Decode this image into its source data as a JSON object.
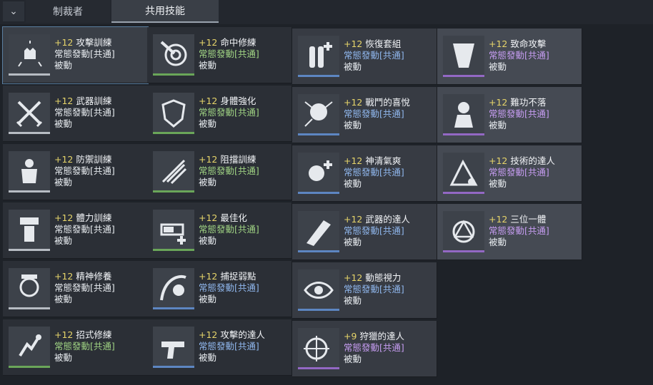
{
  "tabs": [
    "制裁者",
    "共用技能"
  ],
  "active_tab": 1,
  "columns": [
    [
      {
        "lvl": "+12",
        "name": "攻擊訓練",
        "type": "常態發動[共通]",
        "passive": "被動",
        "type_color": "white",
        "icon": "fist-icon"
      },
      {
        "lvl": "+12",
        "name": "武器訓練",
        "type": "常態發動[共通]",
        "passive": "被動",
        "type_color": "white",
        "icon": "crossed-swords-icon"
      },
      {
        "lvl": "+12",
        "name": "防禦訓練",
        "type": "常態發動[共通]",
        "passive": "被動",
        "type_color": "white",
        "icon": "armor-icon"
      },
      {
        "lvl": "+12",
        "name": "體力訓練",
        "type": "常態發動[共通]",
        "passive": "被動",
        "type_color": "white",
        "icon": "body-icon"
      },
      {
        "lvl": "+12",
        "name": "精神修養",
        "type": "常態發動[共通]",
        "passive": "被動",
        "type_color": "white",
        "icon": "mind-icon"
      },
      {
        "lvl": "+12",
        "name": "招式修練",
        "type": "常態發動[共通]",
        "passive": "被動",
        "type_color": "green",
        "icon": "technique-icon"
      }
    ],
    [
      {
        "lvl": "+12",
        "name": "命中修練",
        "type": "常態發動[共通]",
        "passive": "被動",
        "type_color": "green",
        "icon": "target-icon"
      },
      {
        "lvl": "+12",
        "name": "身體強化",
        "type": "常態發動[共通]",
        "passive": "被動",
        "type_color": "green",
        "icon": "shield-icon"
      },
      {
        "lvl": "+12",
        "name": "阻擋訓練",
        "type": "常態發動[共通]",
        "passive": "被動",
        "type_color": "green",
        "icon": "block-icon"
      },
      {
        "lvl": "+12",
        "name": "最佳化",
        "type": "常態發動[共通]",
        "passive": "被動",
        "type_color": "green",
        "icon": "battery-icon"
      },
      {
        "lvl": "+12",
        "name": "捕捉弱點",
        "type": "常態發動[共通]",
        "passive": "被動",
        "type_color": "blue",
        "icon": "weakpoint-icon"
      },
      {
        "lvl": "+12",
        "name": "攻擊的達人",
        "type": "常態發動[共通]",
        "passive": "被動",
        "type_color": "blue",
        "icon": "gun-icon"
      }
    ],
    [
      {
        "lvl": "+12",
        "name": "恢復套組",
        "type": "常態發動[共通]",
        "passive": "被動",
        "type_color": "blue",
        "icon": "recovery-kit-icon"
      },
      {
        "lvl": "+12",
        "name": "戰鬥的喜悅",
        "type": "常態發動[共通]",
        "passive": "被動",
        "type_color": "blue",
        "icon": "joy-icon"
      },
      {
        "lvl": "+12",
        "name": "神清氣爽",
        "type": "常態發動[共通]",
        "passive": "被動",
        "type_color": "blue",
        "icon": "refresh-icon"
      },
      {
        "lvl": "+12",
        "name": "武器的達人",
        "type": "常態發動[共通]",
        "passive": "被動",
        "type_color": "blue",
        "icon": "weapon-master-icon"
      },
      {
        "lvl": "+12",
        "name": "動態視力",
        "type": "常態發動[共通]",
        "passive": "被動",
        "type_color": "blue",
        "icon": "eye-icon"
      },
      {
        "lvl": "+9",
        "name": "狩獵的達人",
        "type": "常態發動[共通]",
        "passive": "被動",
        "type_color": "purple",
        "icon": "hunter-icon"
      }
    ],
    [
      {
        "lvl": "+12",
        "name": "致命攻擊",
        "type": "常態發動[共通]",
        "passive": "被動",
        "type_color": "purple",
        "icon": "fatal-icon"
      },
      {
        "lvl": "+12",
        "name": "難功不落",
        "type": "常態發動[共通]",
        "passive": "被動",
        "type_color": "purple",
        "icon": "fortress-icon"
      },
      {
        "lvl": "+12",
        "name": "技術的達人",
        "type": "常態發動[共通]",
        "passive": "被動",
        "type_color": "purple",
        "icon": "tech-master-icon"
      },
      {
        "lvl": "+12",
        "name": "三位一體",
        "type": "常態發動[共通]",
        "passive": "被動",
        "type_color": "purple",
        "icon": "trinity-icon"
      }
    ]
  ]
}
